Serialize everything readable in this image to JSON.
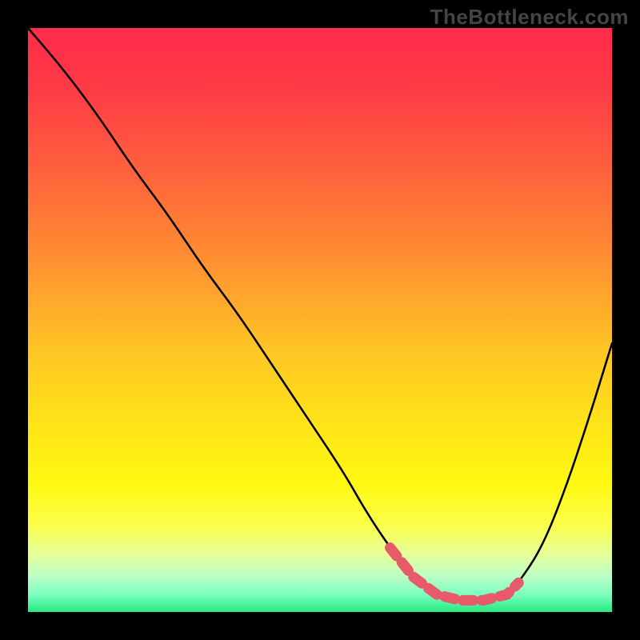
{
  "watermark": "TheBottleneck.com",
  "chart_data": {
    "type": "line",
    "title": "",
    "xlabel": "",
    "ylabel": "",
    "xlim": [
      0,
      100
    ],
    "ylim": [
      0,
      100
    ],
    "series": [
      {
        "name": "curve",
        "x": [
          0,
          6,
          12,
          18,
          24,
          30,
          36,
          42,
          48,
          54,
          58,
          62,
          66,
          70,
          74,
          78,
          82,
          84,
          88,
          92,
          96,
          100
        ],
        "values": [
          100,
          93,
          85,
          76,
          68,
          59,
          51,
          42,
          33,
          24,
          17,
          11,
          6,
          3,
          2,
          2,
          3,
          5,
          11,
          21,
          33,
          46
        ]
      }
    ],
    "pink_segment": {
      "x_start": 62,
      "x_end": 84,
      "y_approx": 3
    },
    "gradient_stops": [
      {
        "pos": 0.0,
        "color": "#ff2b4a"
      },
      {
        "pos": 0.4,
        "color": "#ff8a32"
      },
      {
        "pos": 0.7,
        "color": "#ffe816"
      },
      {
        "pos": 1.0,
        "color": "#25e97e"
      }
    ]
  }
}
